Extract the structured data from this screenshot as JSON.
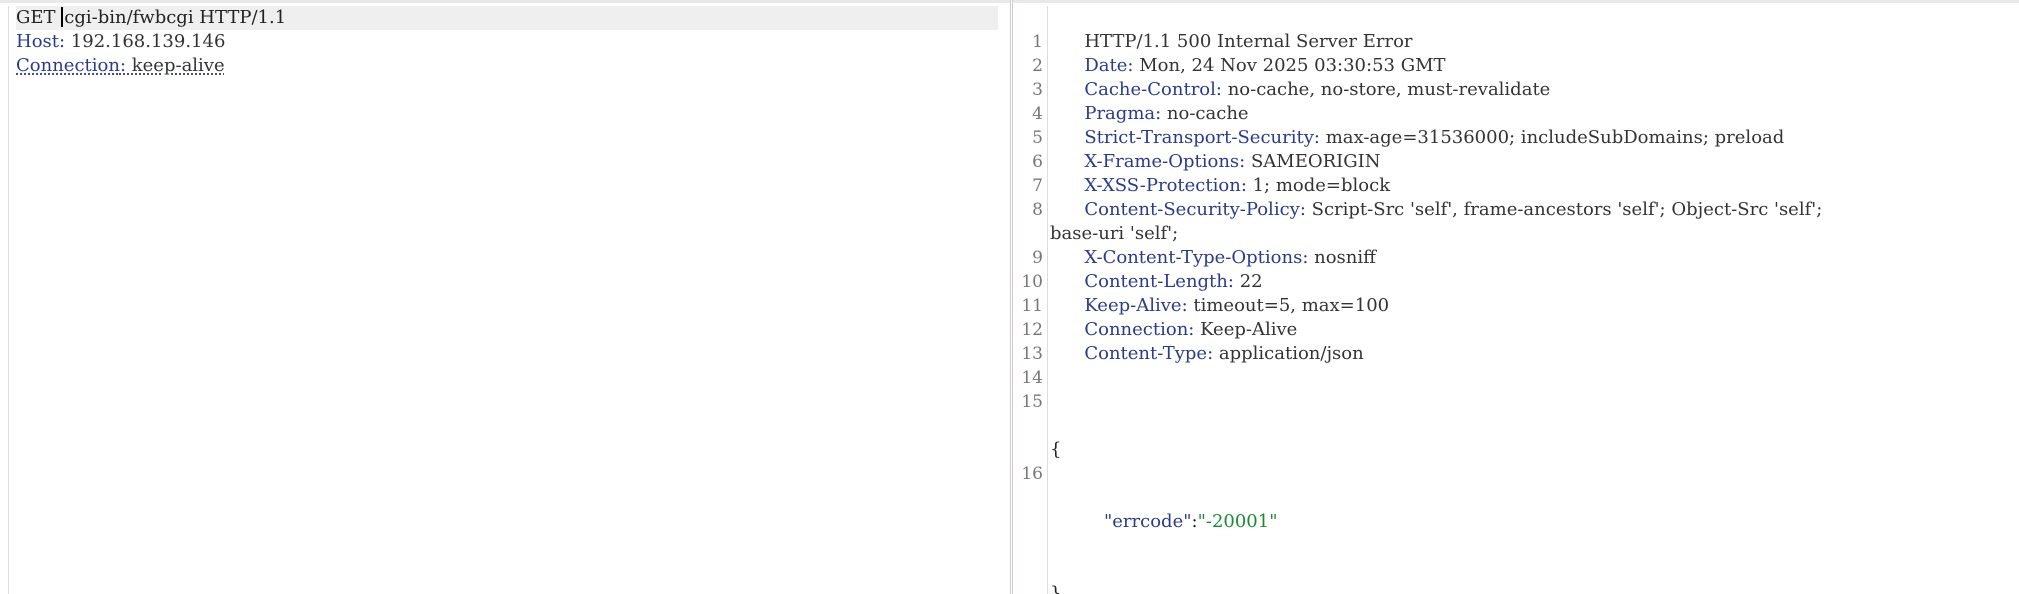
{
  "request": {
    "request_line": "GET /cgi-bin/fwbcgi HTTP/1.1",
    "request_method": "GET ",
    "request_path_rest": "cgi-bin/fwbcgi HTTP/1.1",
    "headers": [
      {
        "name": "Host",
        "value": "192.168.139.146"
      },
      {
        "name": "Connection",
        "value": "keep-alive"
      }
    ]
  },
  "response": {
    "lines": [
      {
        "num": "1",
        "text": "HTTP/1.1 500 Internal Server Error"
      },
      {
        "num": "2",
        "name": "Date",
        "value": "Mon, 24 Nov 2025 03:30:53 GMT"
      },
      {
        "num": "3",
        "name": "Cache-Control",
        "value": "no-cache, no-store, must-revalidate"
      },
      {
        "num": "4",
        "name": "Pragma",
        "value": "no-cache"
      },
      {
        "num": "5",
        "name": "Strict-Transport-Security",
        "value": "max-age=31536000; includeSubDomains; preload"
      },
      {
        "num": "6",
        "name": "X-Frame-Options",
        "value": "SAMEORIGIN"
      },
      {
        "num": "7",
        "name": "X-XSS-Protection",
        "value": "1; mode=block"
      },
      {
        "num": "8",
        "name": "Content-Security-Policy",
        "value": "Script-Src 'self', frame-ancestors 'self'; Object-Src 'self';",
        "value_cont": "base-uri 'self';"
      },
      {
        "num": "9",
        "name": "X-Content-Type-Options",
        "value": "nosniff"
      },
      {
        "num": "10",
        "name": "Content-Length",
        "value": "22"
      },
      {
        "num": "11",
        "name": "Keep-Alive",
        "value": "timeout=5, max=100"
      },
      {
        "num": "12",
        "name": "Connection",
        "value": "Keep-Alive"
      },
      {
        "num": "13",
        "name": "Content-Type",
        "value": "application/json"
      },
      {
        "num": "14"
      },
      {
        "num": "15",
        "json_open": "{",
        "json_key": "\"errcode\"",
        "json_colon": ":",
        "json_value": "\"-20001\"",
        "json_close": "}"
      },
      {
        "num": "16"
      }
    ]
  },
  "colors": {
    "header_name": "#2c3a8a",
    "json_string": "#1d8a37",
    "highlight": "#efefef"
  }
}
